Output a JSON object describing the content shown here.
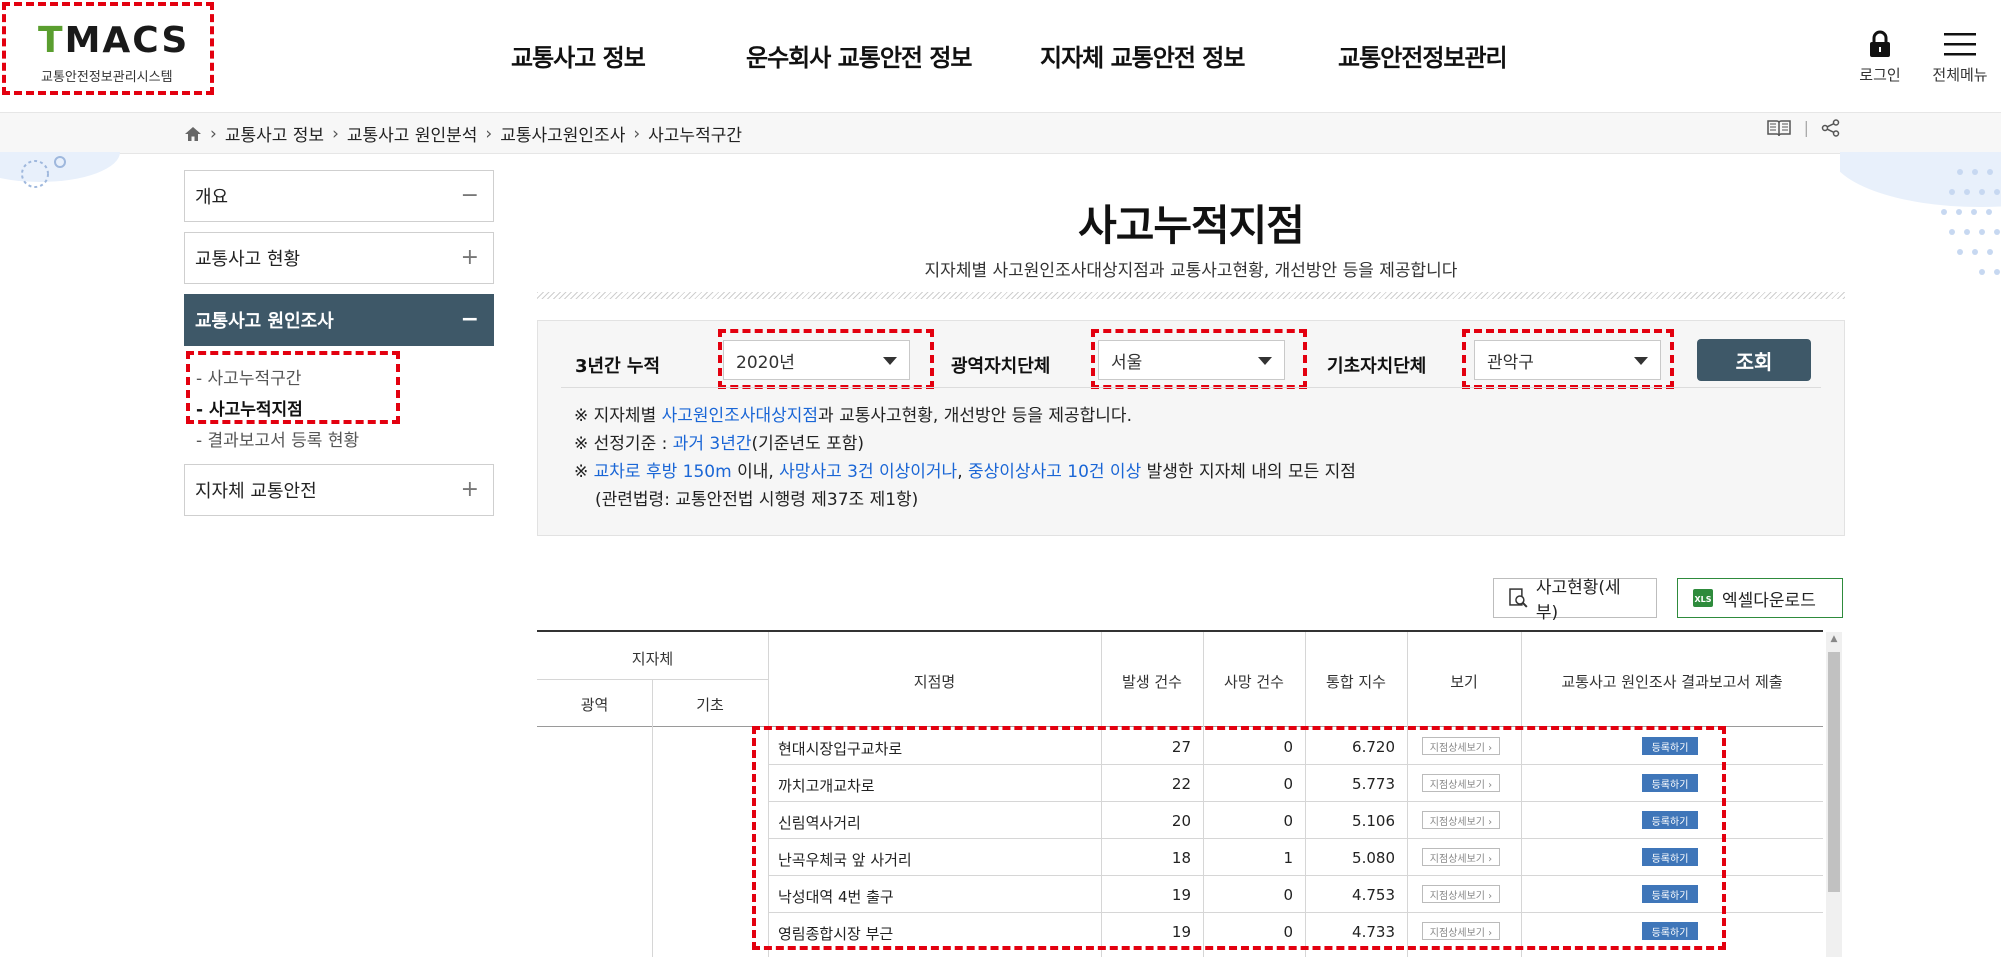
{
  "header": {
    "logo_text": "TMACS",
    "logo_sub": "교통안전정보관리시스템",
    "nav": [
      "교통사고 정보",
      "운수회사 교통안전 정보",
      "지자체 교통안전 정보",
      "교통안전정보관리"
    ],
    "login_label": "로그인",
    "menu_label": "전체메뉴"
  },
  "breadcrumb": [
    "교통사고 정보",
    "교통사고 원인분석",
    "교통사고원인조사",
    "사고누적구간"
  ],
  "sidebar": {
    "items": [
      {
        "label": "개요",
        "sign": "−"
      },
      {
        "label": "교통사고 현황",
        "sign": "+"
      },
      {
        "label": "교통사고 원인조사",
        "sign": "−"
      },
      {
        "label": "지자체 교통안전",
        "sign": "+"
      }
    ],
    "sub_items": [
      "- 사고누적구간",
      "- 사고누적지점",
      "- 결과보고서 등록 현황"
    ]
  },
  "page": {
    "title": "사고누적지점",
    "subtitle": "지자체별 사고원인조사대상지점과 교통사고현황, 개선방안 등을 제공합니다"
  },
  "search": {
    "label_period": "3년간 누적",
    "year_value": "2020년",
    "label_metro": "광역자치단체",
    "metro_value": "서울",
    "label_local": "기초자치단체",
    "local_value": "관악구",
    "button": "조회"
  },
  "notes": {
    "n1_pre": "※ 지자체별 ",
    "n1_hl": "사고원인조사대상지점",
    "n1_post": "과 교통사고현황, 개선방안 등을 제공합니다.",
    "n2_pre": "※ 선정기준 : ",
    "n2_hl": "과거 3년간",
    "n2_post": "(기준년도 포함)",
    "n3_pre": "※ ",
    "n3_hl1": "교차로 후방 150m",
    "n3_mid1": " 이내, ",
    "n3_hl2": "사망사고 3건 이상이거나",
    "n3_mid2": ", ",
    "n3_hl3": "중상이상사고 10건 이상",
    "n3_post": " 발생한 지자체 내의 모든 지점",
    "n4": "(관련법령: 교통안전법 시행령 제37조 제1항)"
  },
  "actions": {
    "detail": "사고현황(세부)",
    "excel": "엑셀다운로드"
  },
  "table": {
    "headers": {
      "region": "지자체",
      "metro": "광역",
      "local": "기초",
      "name": "지점명",
      "occur": "발생 건수",
      "death": "사망 건수",
      "index": "통합 지수",
      "view": "보기",
      "report": "교통사고 원인조사 결과보고서 제출"
    },
    "detail_btn": "지점상세보기 ›",
    "reg_btn": "등록하기",
    "rows": [
      {
        "name": "현대시장입구교차로",
        "occur": "27",
        "death": "0",
        "index": "6.720"
      },
      {
        "name": "까치고개교차로",
        "occur": "22",
        "death": "0",
        "index": "5.773"
      },
      {
        "name": "신림역사거리",
        "occur": "20",
        "death": "0",
        "index": "5.106"
      },
      {
        "name": "난곡우체국 앞 사거리",
        "occur": "18",
        "death": "1",
        "index": "5.080"
      },
      {
        "name": "낙성대역 4번 출구",
        "occur": "19",
        "death": "0",
        "index": "4.753"
      },
      {
        "name": "영림종합시장 부근",
        "occur": "19",
        "death": "0",
        "index": "4.733"
      }
    ]
  }
}
